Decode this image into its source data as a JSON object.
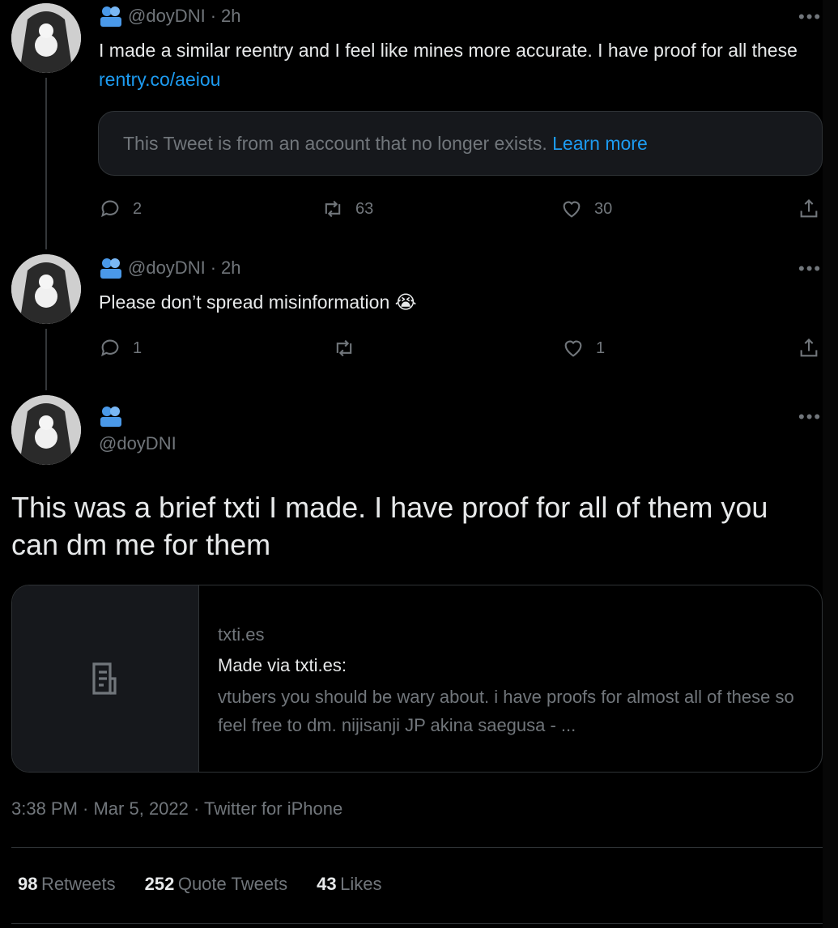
{
  "tweets": [
    {
      "handle": "@doyDNI",
      "sep": "·",
      "time": "2h",
      "text": "I made a similar reentry and I feel like mines more accurate. I have proof for all these ",
      "link": "rentry.co/aeiou",
      "quote_notice": "This Tweet is from an account that no longer exists. ",
      "quote_learn_more": "Learn more",
      "replies": "2",
      "retweets": "63",
      "likes": "30"
    },
    {
      "handle": "@doyDNI",
      "sep": "·",
      "time": "2h",
      "text": "Please don’t spread misinformation",
      "emoji": "😭",
      "replies": "1",
      "retweets": "",
      "likes": "1"
    }
  ],
  "main_tweet": {
    "handle": "@doyDNI",
    "text": "This was a brief txti I made. I have proof for all of them you can dm me for them",
    "card": {
      "domain": "txti.es",
      "title": "Made via txti.es:",
      "description": "vtubers you should be wary about. i have proofs for almost all of these so feel free to dm. nijisanji JP akina saegusa - ..."
    },
    "timestamp": "3:38 PM · Mar 5, 2022 · Twitter for iPhone",
    "stats": {
      "retweets_count": "98",
      "retweets_label": "Retweets",
      "quotes_count": "252",
      "quotes_label": "Quote Tweets",
      "likes_count": "43",
      "likes_label": "Likes"
    }
  },
  "colors": {
    "background": "#000000",
    "text": "#e7e9ea",
    "muted": "#71767b",
    "accent": "#1d9bf0",
    "border": "#2f3336",
    "badge": "#4a99e9"
  },
  "icons": {
    "more": "more-horizontal-icon",
    "reply": "reply-icon",
    "retweet": "retweet-icon",
    "like": "heart-icon",
    "share": "share-icon",
    "badge": "users-badge-icon",
    "card": "document-icon"
  }
}
